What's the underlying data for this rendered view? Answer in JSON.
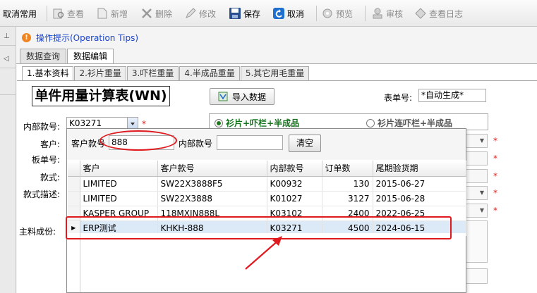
{
  "toolbar": {
    "items": [
      {
        "label": "取消常用",
        "icon": "cancel-favorite-icon",
        "enabled": true
      },
      {
        "label": "查看",
        "icon": "view-icon",
        "enabled": false
      },
      {
        "label": "新增",
        "icon": "new-doc-icon",
        "enabled": false
      },
      {
        "label": "删除",
        "icon": "delete-x-icon",
        "enabled": false
      },
      {
        "label": "修改",
        "icon": "edit-pencil-icon",
        "enabled": false
      },
      {
        "label": "保存",
        "icon": "save-disk-icon",
        "enabled": true
      },
      {
        "label": "取消",
        "icon": "undo-arrow-icon",
        "enabled": true
      },
      {
        "label": "预览",
        "icon": "preview-gear-icon",
        "enabled": false
      },
      {
        "label": "审核",
        "icon": "approve-stamp-icon",
        "enabled": false
      },
      {
        "label": "查看日志",
        "icon": "log-icon",
        "enabled": false
      }
    ]
  },
  "tips": {
    "text": "操作提示(Operation Tips)"
  },
  "main_tabs": [
    {
      "label": "数据查询"
    },
    {
      "label": "数据编辑"
    }
  ],
  "sub_tabs": [
    {
      "label": "1.基本资料"
    },
    {
      "label": "2.衫片重量"
    },
    {
      "label": "3.吓栏重量"
    },
    {
      "label": "4.半成品重量"
    },
    {
      "label": "5.其它用毛重量"
    }
  ],
  "form": {
    "title": "单件用量计算表(WN)",
    "import_label": "导入数据",
    "order_no_label": "表单号:",
    "order_no_value": "*自动生成*",
    "internal_no_label": "内部款号:",
    "internal_no_value": "K03271",
    "required_mark": "*",
    "customer_label": "客户:",
    "board_label": "板单号:",
    "style_label": "款式:",
    "style_desc_label": "款式描述:",
    "material_label": "主料成份:",
    "radio_option1": "衫片+吓栏+半成品",
    "radio_option2": "衫片连吓栏+半成品"
  },
  "popup": {
    "customer_style_label": "客户款号",
    "customer_style_value": "888",
    "internal_no_label": "内部款号",
    "internal_no_value": "",
    "clear_label": "清空",
    "columns": [
      "客户",
      "客户款号",
      "内部款号",
      "订单数",
      "尾期验货期"
    ],
    "rows": [
      {
        "customer": "LIMITED",
        "style": "SW22X3888F5",
        "internal": "K00932",
        "qty": "130",
        "date": "2015-06-27"
      },
      {
        "customer": "LIMITED",
        "style": "SW22X3888",
        "internal": "K01027",
        "qty": "3127",
        "date": "2015-06-28"
      },
      {
        "customer": "KASPER GROUP",
        "style": "118MXJN888L",
        "internal": "K03102",
        "qty": "2400",
        "date": "2022-06-25"
      },
      {
        "customer": "ERP测试",
        "style": "KHKH-888",
        "internal": "K03271",
        "qty": "4500",
        "date": "2024-06-15"
      }
    ]
  },
  "colors": {
    "annotation": "#e0191f",
    "tips": "#1a44c8",
    "selected_row": "#dce9f7"
  }
}
